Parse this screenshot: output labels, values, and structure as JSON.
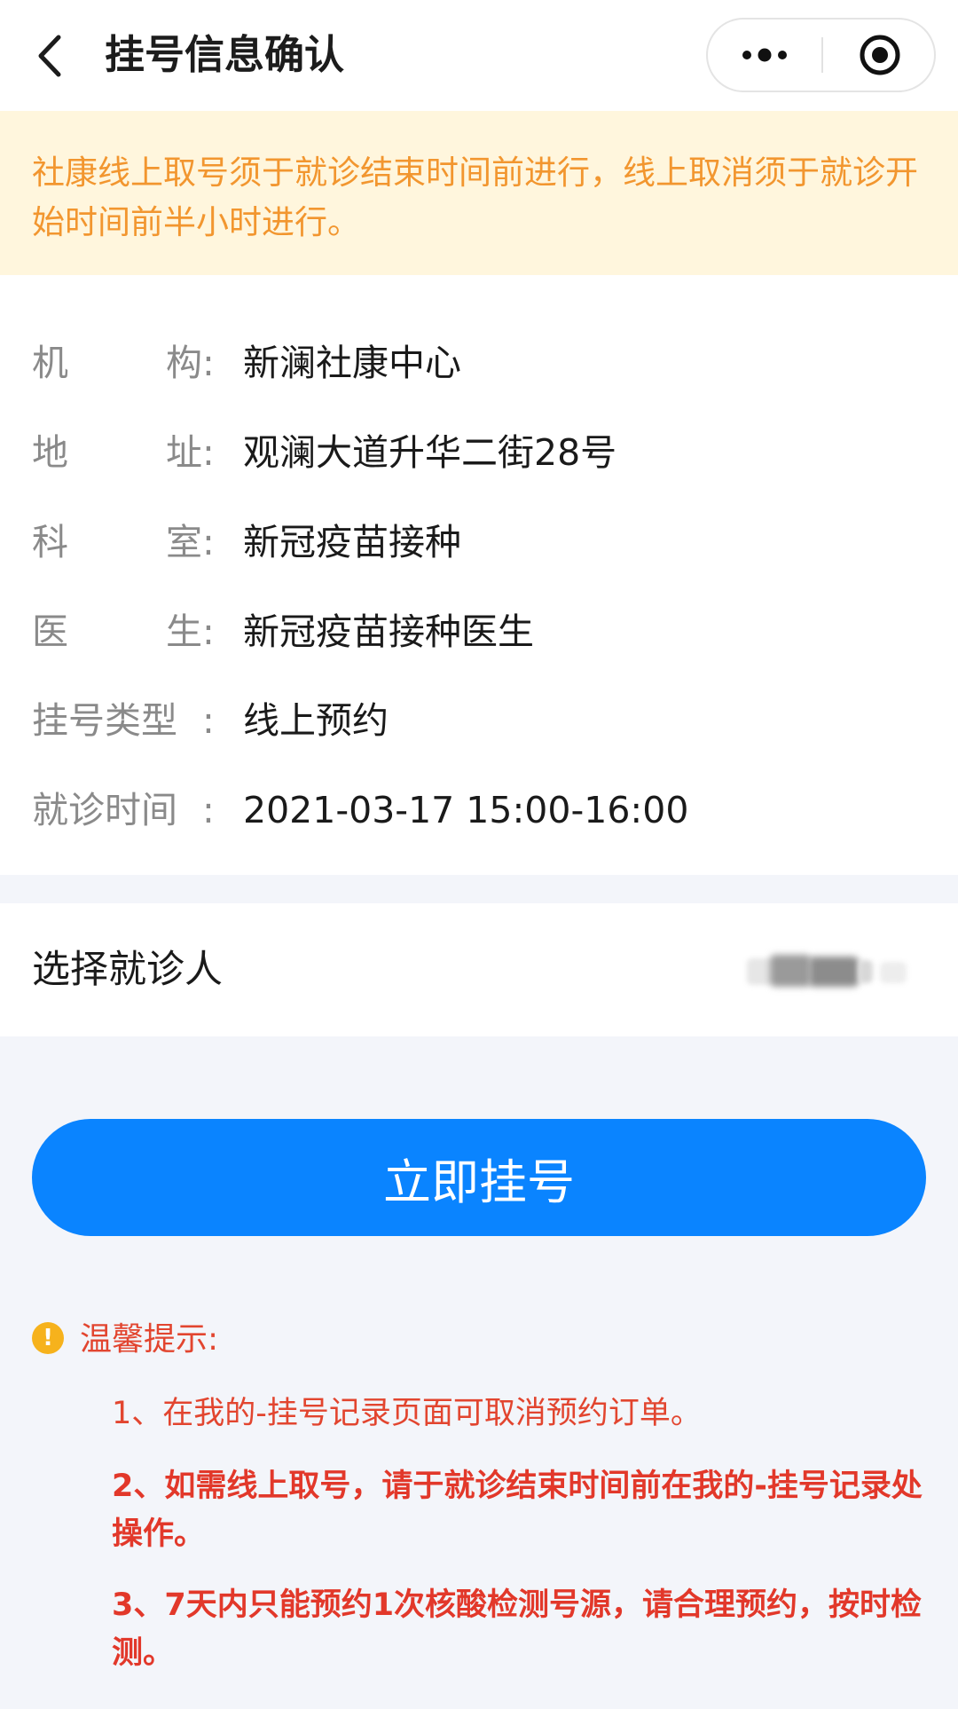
{
  "header": {
    "title": "挂号信息确认",
    "back_icon": "chevron-left-icon",
    "more_icon": "more-dots-icon",
    "close_icon": "target-close-icon"
  },
  "notice": {
    "text": "社康线上取号须于就诊结束时间前进行，线上取消须于就诊开始时间前半小时进行。",
    "background": "#fff6dd",
    "color": "#f2962f"
  },
  "info": {
    "institution": {
      "label_chars": [
        "机",
        "构"
      ],
      "colon": ":",
      "value": "新澜社康中心"
    },
    "address": {
      "label_chars": [
        "地",
        "址"
      ],
      "colon": ":",
      "value": "观澜大道升华二街28号"
    },
    "department": {
      "label_chars": [
        "科",
        "室"
      ],
      "colon": ":",
      "value": "新冠疫苗接种"
    },
    "doctor": {
      "label_chars": [
        "医",
        "生"
      ],
      "colon": ":",
      "value": "新冠疫苗接种医生"
    },
    "reg_type": {
      "label": "挂号类型",
      "colon": ":",
      "value": "线上预约"
    },
    "visit_time": {
      "label": "就诊时间",
      "colon": ":",
      "value": "2021-03-17 15:00-16:00"
    }
  },
  "patient": {
    "label": "选择就诊人"
  },
  "actions": {
    "register_label": "立即挂号",
    "accent": "#0a84ff"
  },
  "tips": {
    "icon": "warning-icon",
    "title": "温馨提示:",
    "items": [
      "1、在我的-挂号记录页面可取消预约订单。",
      "2、如需线上取号，请于就诊结束时间前在我的-挂号记录处操作。",
      "3、7天内只能预约1次核酸检测号源，请合理预约，按时检测。"
    ],
    "color": "#e2452f"
  }
}
